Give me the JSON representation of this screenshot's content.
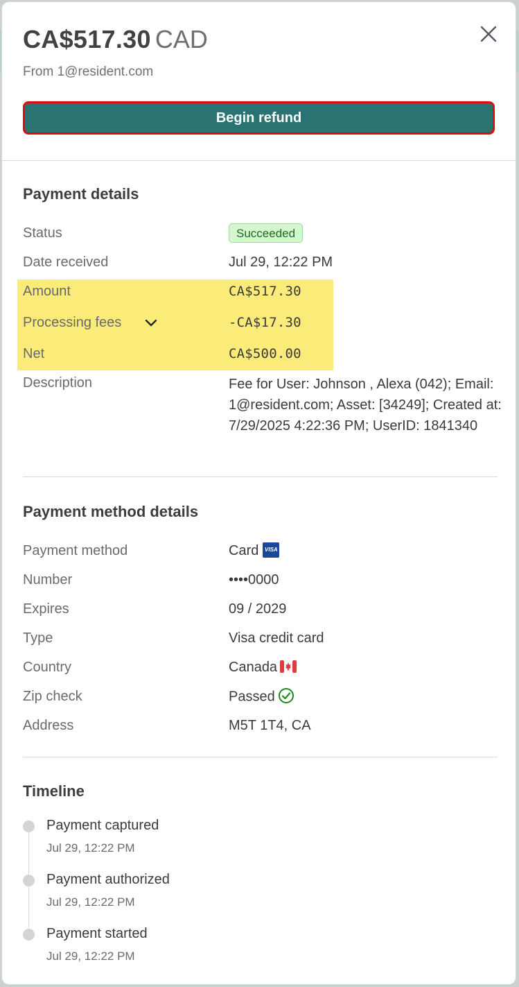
{
  "header": {
    "amount": "CA$517.30",
    "currency": "CAD",
    "from": "From 1@resident.com",
    "refund_label": "Begin refund"
  },
  "payment_details": {
    "title": "Payment details",
    "status_label": "Status",
    "status_value": "Succeeded",
    "date_label": "Date received",
    "date_value": "Jul 29, 12:22 PM",
    "amount_label": "Amount",
    "amount_value": "CA$517.30",
    "fees_label": "Processing fees",
    "fees_value": "-CA$17.30",
    "net_label": "Net",
    "net_value": "CA$500.00",
    "description_label": "Description",
    "description_value": "Fee for User: Johnson , Alexa (042); Email: 1@resident.com; Asset: [34249]; Created at: 7/29/2025 4:22:36 PM; UserID: 1841340"
  },
  "payment_method": {
    "title": "Payment method details",
    "method_label": "Payment method",
    "method_value": "Card",
    "card_brand_text": "VISA",
    "number_label": "Number",
    "number_value": "••••0000",
    "expires_label": "Expires",
    "expires_value": "09 / 2029",
    "type_label": "Type",
    "type_value": "Visa credit card",
    "country_label": "Country",
    "country_value": "Canada",
    "zip_label": "Zip check",
    "zip_value": "Passed",
    "address_label": "Address",
    "address_value": "M5T 1T4, CA"
  },
  "timeline": {
    "title": "Timeline",
    "events": [
      {
        "title": "Payment captured",
        "time": "Jul 29, 12:22 PM"
      },
      {
        "title": "Payment authorized",
        "time": "Jul 29, 12:22 PM"
      },
      {
        "title": "Payment started",
        "time": "Jul 29, 12:22 PM"
      }
    ]
  },
  "colors": {
    "refund_button_bg": "#2b7373",
    "refund_button_border": "#e10d0d",
    "highlight": "#fbeb79",
    "status_badge_bg": "#d5f7cf",
    "status_badge_text": "#1c6b21"
  },
  "icons": {
    "close": "close-icon",
    "expand": "chevron-down-icon",
    "card": "visa-icon",
    "country": "canada-flag-icon",
    "zip": "check-circle-icon"
  }
}
